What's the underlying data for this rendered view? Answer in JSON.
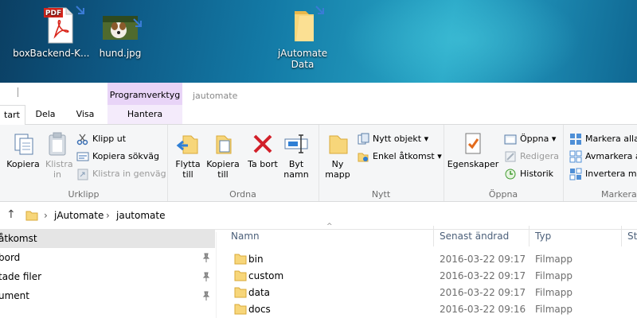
{
  "desktop": {
    "icons": [
      {
        "label": "box"
      },
      {
        "label": "Backend-K...",
        "badge": "PDF"
      },
      {
        "label": "hund.jpg"
      },
      {
        "label": "jAutomate\nData"
      }
    ]
  },
  "window": {
    "title": "jautomate",
    "contextual_tab_group": "Programverktyg",
    "tabs": [
      "tart",
      "Dela",
      "Visa",
      "Hantera"
    ]
  },
  "ribbon": {
    "groups": [
      {
        "name": "Urklipp",
        "big": [
          {
            "label": "Kopiera"
          },
          {
            "label": "Klistra in",
            "disabled": true
          }
        ],
        "small": [
          {
            "label": "Klipp ut",
            "icon": "scissors-icon"
          },
          {
            "label": "Kopiera sökväg",
            "icon": "copy-path-icon"
          },
          {
            "label": "Klistra in genväg",
            "icon": "paste-shortcut-icon",
            "disabled": true
          }
        ]
      },
      {
        "name": "Ordna",
        "big": [
          {
            "label": "Flytta till"
          },
          {
            "label": "Kopiera till"
          },
          {
            "label": "Ta bort"
          },
          {
            "label": "Byt namn"
          }
        ]
      },
      {
        "name": "Nytt",
        "big": [
          {
            "label": "Ny mapp"
          }
        ],
        "small": [
          {
            "label": "Nytt objekt"
          },
          {
            "label": "Enkel åtkomst"
          }
        ]
      },
      {
        "name": "Öppna",
        "big": [
          {
            "label": "Egenskaper"
          }
        ],
        "small": [
          {
            "label": "Öppna"
          },
          {
            "label": "Redigera",
            "disabled": true
          },
          {
            "label": "Historik"
          }
        ]
      },
      {
        "name": "Markera",
        "small": [
          {
            "label": "Markera alla"
          },
          {
            "label": "Avmarkera al"
          },
          {
            "label": "Invertera mar"
          }
        ]
      }
    ]
  },
  "address": {
    "crumbs": [
      "jAutomate",
      "jautomate"
    ]
  },
  "nav": [
    {
      "label": "åtkomst",
      "selected": true
    },
    {
      "label": "bord",
      "pinned": true
    },
    {
      "label": "tade filer",
      "pinned": true
    },
    {
      "label": "ument",
      "pinned": true
    }
  ],
  "columns": [
    "Namn",
    "Senast ändrad",
    "Typ",
    "St"
  ],
  "files": [
    {
      "name": "bin",
      "modified": "2016-03-22 09:17",
      "type": "Filmapp"
    },
    {
      "name": "custom",
      "modified": "2016-03-22 09:17",
      "type": "Filmapp"
    },
    {
      "name": "data",
      "modified": "2016-03-22 09:17",
      "type": "Filmapp"
    },
    {
      "name": "docs",
      "modified": "2016-03-22 09:16",
      "type": "Filmapp"
    }
  ]
}
